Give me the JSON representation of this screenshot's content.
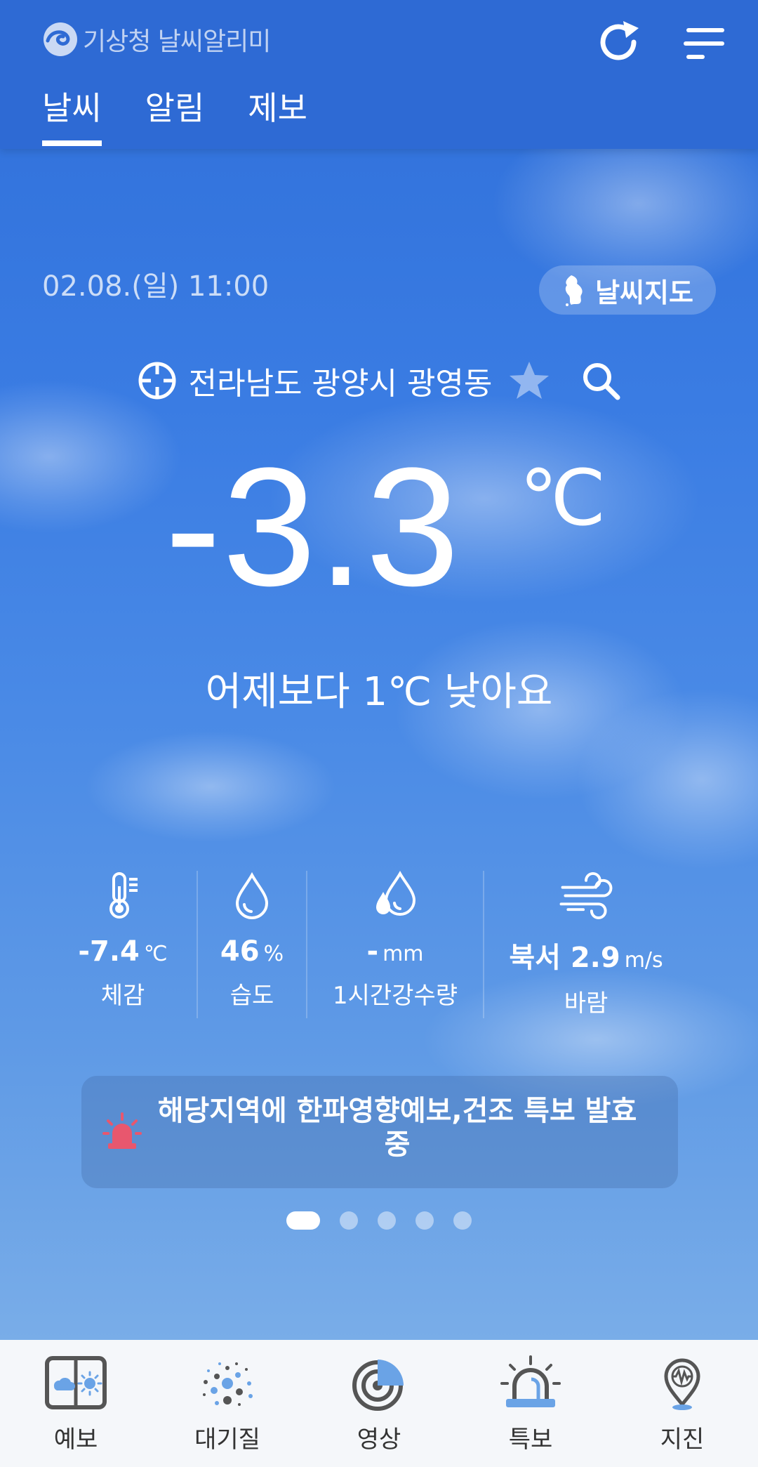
{
  "header": {
    "app_title": "기상청 날씨알리미",
    "tabs": [
      {
        "label": "날씨",
        "active": true
      },
      {
        "label": "알림",
        "active": false
      },
      {
        "label": "제보",
        "active": false
      }
    ]
  },
  "weather": {
    "datetime": "02.08.(일) 11:00",
    "map_button_label": "날씨지도",
    "location": "전라남도 광양시 광영동",
    "temperature": "-3.3",
    "temperature_unit": "℃",
    "comparison": "어제보다 1℃ 낮아요"
  },
  "stats": [
    {
      "value": "-7.4",
      "unit": "℃",
      "label": "체감",
      "icon": "thermometer-icon"
    },
    {
      "value": "46",
      "unit": "%",
      "label": "습도",
      "icon": "humidity-drop-icon"
    },
    {
      "value": "-",
      "unit": "mm",
      "label": "1시간강수량",
      "icon": "rain-drops-icon"
    },
    {
      "value": "북서 2.9",
      "unit": "m/s",
      "label": "바람",
      "icon": "wind-icon"
    }
  ],
  "alert": {
    "text": "해당지역에 한파영향예보,건조 특보 발효중",
    "icon": "siren-icon"
  },
  "pagination": {
    "total": 5,
    "active_index": 0
  },
  "bottom_nav": [
    {
      "label": "예보",
      "icon": "forecast-icon"
    },
    {
      "label": "대기질",
      "icon": "air-quality-icon"
    },
    {
      "label": "영상",
      "icon": "radar-icon"
    },
    {
      "label": "특보",
      "icon": "warning-siren-icon"
    },
    {
      "label": "지진",
      "icon": "earthquake-pin-icon"
    }
  ],
  "colors": {
    "header_bg": "#2e6ad4",
    "sky_top": "#2f6fd9",
    "sky_bottom": "#79ade8",
    "alert_red": "#e8576e",
    "nav_accent": "#6aa3e6"
  }
}
